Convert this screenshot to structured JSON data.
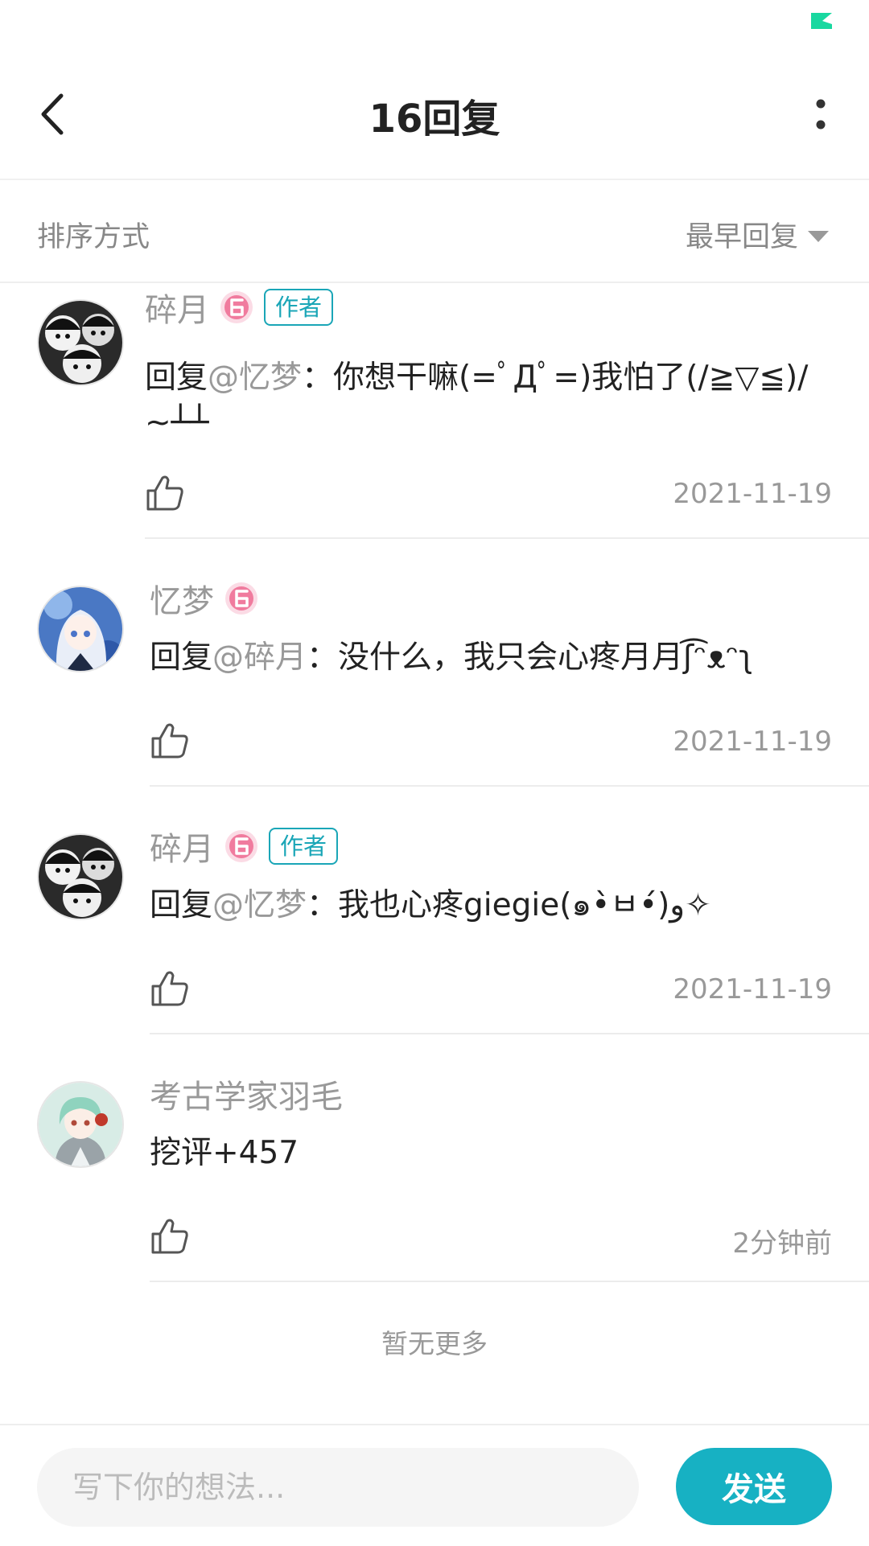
{
  "header": {
    "title": "16回复"
  },
  "sort": {
    "label": "排序方式",
    "value": "最早回复"
  },
  "comments": [
    {
      "username": "碎月",
      "author_tag": "作者",
      "reply_prefix": "回复",
      "mention": "@忆梦",
      "colon": "：",
      "text": "你想干嘛(=ﾟДﾟ=)我怕了(/≧▽≦)/~┴┴",
      "date": "2021-11-19",
      "avatar": "manga-bw-avatar"
    },
    {
      "username": "忆梦",
      "author_tag": "",
      "reply_prefix": "回复",
      "mention": "@碎月",
      "colon": "：",
      "text": "没什么，我只会心疼月月ʃ͡ᵔᴥᵔʅ",
      "date": "2021-11-19",
      "avatar": "anime-girl-avatar"
    },
    {
      "username": "碎月",
      "author_tag": "作者",
      "reply_prefix": "回复",
      "mention": "@忆梦",
      "colon": "：",
      "text": "我也心疼giegie(๑•̀ㅂ•́)و✧",
      "date": "2021-11-19",
      "avatar": "manga-bw-avatar"
    },
    {
      "username": "考古学家羽毛",
      "author_tag": "",
      "reply_prefix": "",
      "mention": "",
      "colon": "",
      "text": "挖评+457",
      "date": "2分钟前",
      "avatar": "green-hair-boy-avatar"
    }
  ],
  "footer_note": "暂无更多",
  "input": {
    "placeholder": "写下你的想法..."
  },
  "send_label": "发送",
  "colors": {
    "accent": "#17b1c3",
    "level_badge": "#f07b9e",
    "status_icon": "#19d8a0"
  }
}
